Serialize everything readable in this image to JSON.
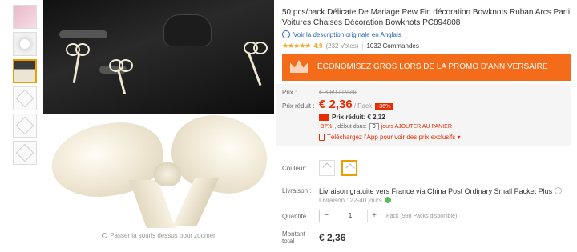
{
  "gallery": {
    "zoom_hint": "Passer la souris dessus pour zoomer"
  },
  "product": {
    "title": "50 pcs/pack Délicate De Mariage Pew Fin décoration Bowknots Ruban Arcs Parti Voitures Chaises Décoration Bowknots PC894808",
    "original_link": "Voir la description originale en Anglais",
    "rating": "4.9",
    "votes": "(232 Votes)",
    "orders": "1032 Commandes"
  },
  "promo": {
    "text": "ÉCONOMISEZ GROS LORS DE LA PROMO D'ANNIVERSAIRE",
    "accent": "#f46b1a"
  },
  "price": {
    "label": "Prix :",
    "old_value": "€ 3,69 / Pack",
    "reduced_label": "Prix réduit :",
    "value": "€ 2,36",
    "per": "/ Pack",
    "discount": "-36%",
    "sub_label": "Prix réduit: € 2,32",
    "countdown_discount": "-37%",
    "countdown_text": ", début dans:",
    "countdown_days": "9",
    "countdown_tail": "jours AJOUTER AU PANIER",
    "app_link": "Téléchargez l'App pour voir des prix exclusifs ▾",
    "accent": "#e62e04"
  },
  "color": {
    "label": "Couleur:"
  },
  "shipping": {
    "label": "Livraison :",
    "main": "Livraison gratuite vers France via China Post Ordinary Small Packet Plus",
    "sub": "Livraison : 22-40 jours"
  },
  "quantity": {
    "label": "Quantité :",
    "minus": "−",
    "value": "1",
    "plus": "+",
    "available": "Pack (998 Packs disponible)"
  },
  "total": {
    "label": "Montant total :",
    "value": "€ 2,36"
  }
}
